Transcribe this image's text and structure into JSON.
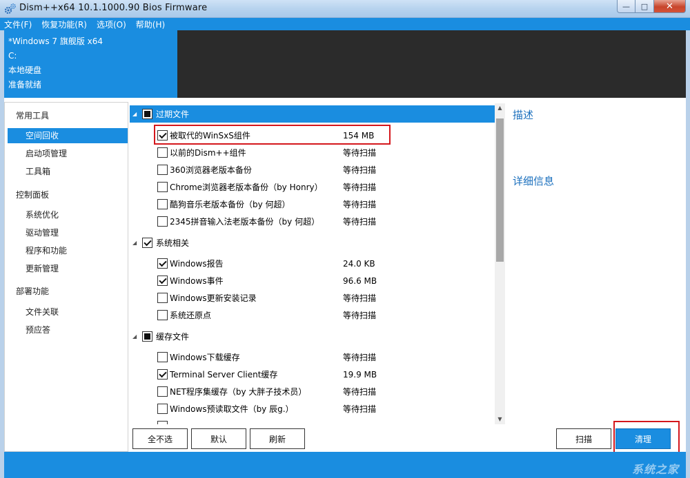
{
  "window": {
    "title": "Dism++x64 10.1.1000.90 Bios Firmware",
    "minimize": "—",
    "maximize": "□",
    "close": "✕"
  },
  "menu": [
    "文件(F)",
    "恢复功能(R)",
    "选项(O)",
    "帮助(H)"
  ],
  "info": {
    "os": "*Windows 7 旗舰版 x64",
    "drive": "C:",
    "disk": "本地硬盘",
    "status": "准备就绪"
  },
  "sidebar": {
    "groups": [
      {
        "label": "常用工具",
        "items": [
          "空间回收",
          "启动项管理",
          "工具箱"
        ]
      },
      {
        "label": "控制面板",
        "items": [
          "系统优化",
          "驱动管理",
          "程序和功能",
          "更新管理"
        ]
      },
      {
        "label": "部署功能",
        "items": [
          "文件关联",
          "预应答"
        ]
      }
    ],
    "active": "空间回收"
  },
  "list": {
    "groups": [
      {
        "label": "过期文件",
        "state": "partial",
        "selected": true,
        "items": [
          {
            "label": "被取代的WinSxS组件",
            "size": "154 MB",
            "checked": true
          },
          {
            "label": "以前的Dism++组件",
            "size": "等待扫描",
            "checked": false
          },
          {
            "label": "360浏览器老版本备份",
            "size": "等待扫描",
            "checked": false
          },
          {
            "label": "Chrome浏览器老版本备份（by Honry）",
            "size": "等待扫描",
            "checked": false
          },
          {
            "label": "酷狗音乐老版本备份（by 何超）",
            "size": "等待扫描",
            "checked": false
          },
          {
            "label": "2345拼音输入法老版本备份（by 何超）",
            "size": "等待扫描",
            "checked": false
          }
        ]
      },
      {
        "label": "系统相关",
        "state": "checked",
        "selected": false,
        "items": [
          {
            "label": "Windows报告",
            "size": "24.0 KB",
            "checked": true
          },
          {
            "label": "Windows事件",
            "size": "96.6 MB",
            "checked": true
          },
          {
            "label": "Windows更新安装记录",
            "size": "等待扫描",
            "checked": false
          },
          {
            "label": "系统还原点",
            "size": "等待扫描",
            "checked": false
          }
        ]
      },
      {
        "label": "缓存文件",
        "state": "partial",
        "selected": false,
        "items": [
          {
            "label": "Windows下载缓存",
            "size": "等待扫描",
            "checked": false
          },
          {
            "label": "Terminal Server Client缓存",
            "size": "19.9 MB",
            "checked": true
          },
          {
            "label": "NET程序集缓存（by 大胖子技术员）",
            "size": "等待扫描",
            "checked": false
          },
          {
            "label": "Windows预读取文件（by 辰g.）",
            "size": "等待扫描",
            "checked": false
          }
        ]
      }
    ]
  },
  "right_panel": {
    "description": "描述",
    "details": "详细信息"
  },
  "buttons": {
    "deselect_all": "全不选",
    "default": "默认",
    "refresh": "刷新",
    "scan": "扫描",
    "clean": "清理"
  },
  "watermark": "系统之家",
  "colors": {
    "accent": "#1a8de0",
    "highlight": "#d4161c"
  }
}
